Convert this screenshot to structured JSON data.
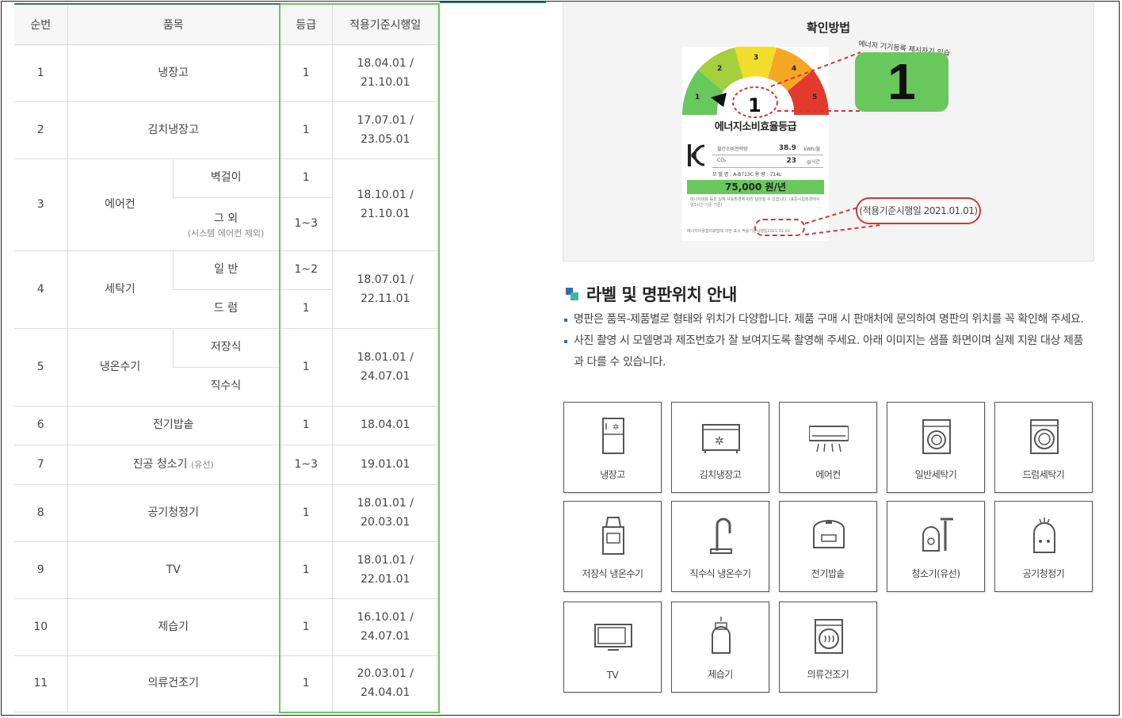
{
  "table": {
    "headers": {
      "no": "순번",
      "item": "품목",
      "grade": "등급",
      "date": "적용기준시행일"
    },
    "rows": [
      {
        "no": "1",
        "item": "냉장고",
        "grade": "1",
        "date1": "18.04.01 /",
        "date2": "21.10.01"
      },
      {
        "no": "2",
        "item": "김치냉장고",
        "grade": "1",
        "date1": "17.07.01 /",
        "date2": "23.05.01"
      },
      {
        "no": "3",
        "item": "에어컨",
        "sub1": "벽걸이",
        "grade1": "1",
        "sub2": "그 외",
        "sub2_note": "(시스템 에어컨 제외)",
        "grade2": "1~3",
        "date1": "18.10.01 /",
        "date2": "21.10.01"
      },
      {
        "no": "4",
        "item": "세탁기",
        "sub1": "일 반",
        "grade1": "1~2",
        "sub2": "드 럼",
        "grade2": "1",
        "date1": "18.07.01 /",
        "date2": "22.11.01"
      },
      {
        "no": "5",
        "item": "냉온수기",
        "sub1": "저장식",
        "sub2": "직수식",
        "grade": "1",
        "date1": "18.01.01 /",
        "date2": "24.07.01"
      },
      {
        "no": "6",
        "item": "전기밥솥",
        "grade": "1",
        "date": "18.04.01"
      },
      {
        "no": "7",
        "item": "진공 청소기",
        "item_suffix": "(유선)",
        "grade": "1~3",
        "date": "19.01.01"
      },
      {
        "no": "8",
        "item": "공기청정기",
        "grade": "1",
        "date1": "18.01.01 /",
        "date2": "20.03.01"
      },
      {
        "no": "9",
        "item": "TV",
        "grade": "1",
        "date1": "18.01.01 /",
        "date2": "22.01.01"
      },
      {
        "no": "10",
        "item": "제습기",
        "grade": "1",
        "date1": "16.10.01 /",
        "date2": "24.07.01"
      },
      {
        "no": "11",
        "item": "의류건조기",
        "grade": "1",
        "date1": "20.03.01 /",
        "date2": "24.04.01"
      }
    ]
  },
  "label_box": {
    "title": "확인방법",
    "gauge_numbers": [
      "1",
      "2",
      "3",
      "4",
      "5"
    ],
    "grade": "1",
    "label_title": "에너지소비효율등급",
    "spec": [
      {
        "label": "월간소비전력량",
        "value": "38.9",
        "unit": "kWh/월"
      },
      {
        "label": "CO₂",
        "value": "23",
        "unit": "g/시간"
      }
    ],
    "model": "모 델 명 : A-B713C     용 량 : 714L",
    "price": "75,000 원/년",
    "fine_print": "에너지비용 등은 실제 사용환경에 따라 달라질 수 있습니다. (표준시험환경에서 일3시간 기준 기준)",
    "date_line": "에너지이용합리화법에 의한 표시",
    "date_small": "적용기준시행일2021.01.01",
    "zoom_grade": "1",
    "zoom_arc_text": "에너지 기기등록 제시자기 있습",
    "callout": "(적용기준시행일 2021.01.01)",
    "colors": {
      "green": "#69c85c",
      "red": "#d63333"
    }
  },
  "guide": {
    "title": "라벨 및 명판위치 안내",
    "bullets": [
      "명판은 품목-제품별로 형태와 위치가 다양합니다. 제품 구매 시 판매처에 문의하여 명판의 위치를 꼭 확인해 주세요.",
      "사진 촬영 시 모델명과 제조번호가 잘 보여지도록 촬영해 주세요. 아래 이미지는 샘플 화면이며 실제 지원 대상 제품과 다를 수 있습니다."
    ],
    "tiles": [
      {
        "label": "냉장고",
        "icon": "refrigerator-icon"
      },
      {
        "label": "김치냉장고",
        "icon": "kimchi-refrigerator-icon"
      },
      {
        "label": "에어컨",
        "icon": "air-conditioner-icon"
      },
      {
        "label": "일반세탁기",
        "icon": "top-load-washer-icon"
      },
      {
        "label": "드럼세탁기",
        "icon": "drum-washer-icon"
      },
      {
        "label": "저장식 냉온수기",
        "icon": "storage-water-dispenser-icon"
      },
      {
        "label": "직수식 냉온수기",
        "icon": "direct-water-dispenser-icon"
      },
      {
        "label": "전기밥솥",
        "icon": "rice-cooker-icon"
      },
      {
        "label": "청소기(유선)",
        "icon": "vacuum-cleaner-icon"
      },
      {
        "label": "공기청정기",
        "icon": "air-purifier-icon"
      },
      {
        "label": "TV",
        "icon": "tv-icon"
      },
      {
        "label": "제습기",
        "icon": "dehumidifier-icon"
      },
      {
        "label": "의류건조기",
        "icon": "clothes-dryer-icon"
      }
    ]
  }
}
